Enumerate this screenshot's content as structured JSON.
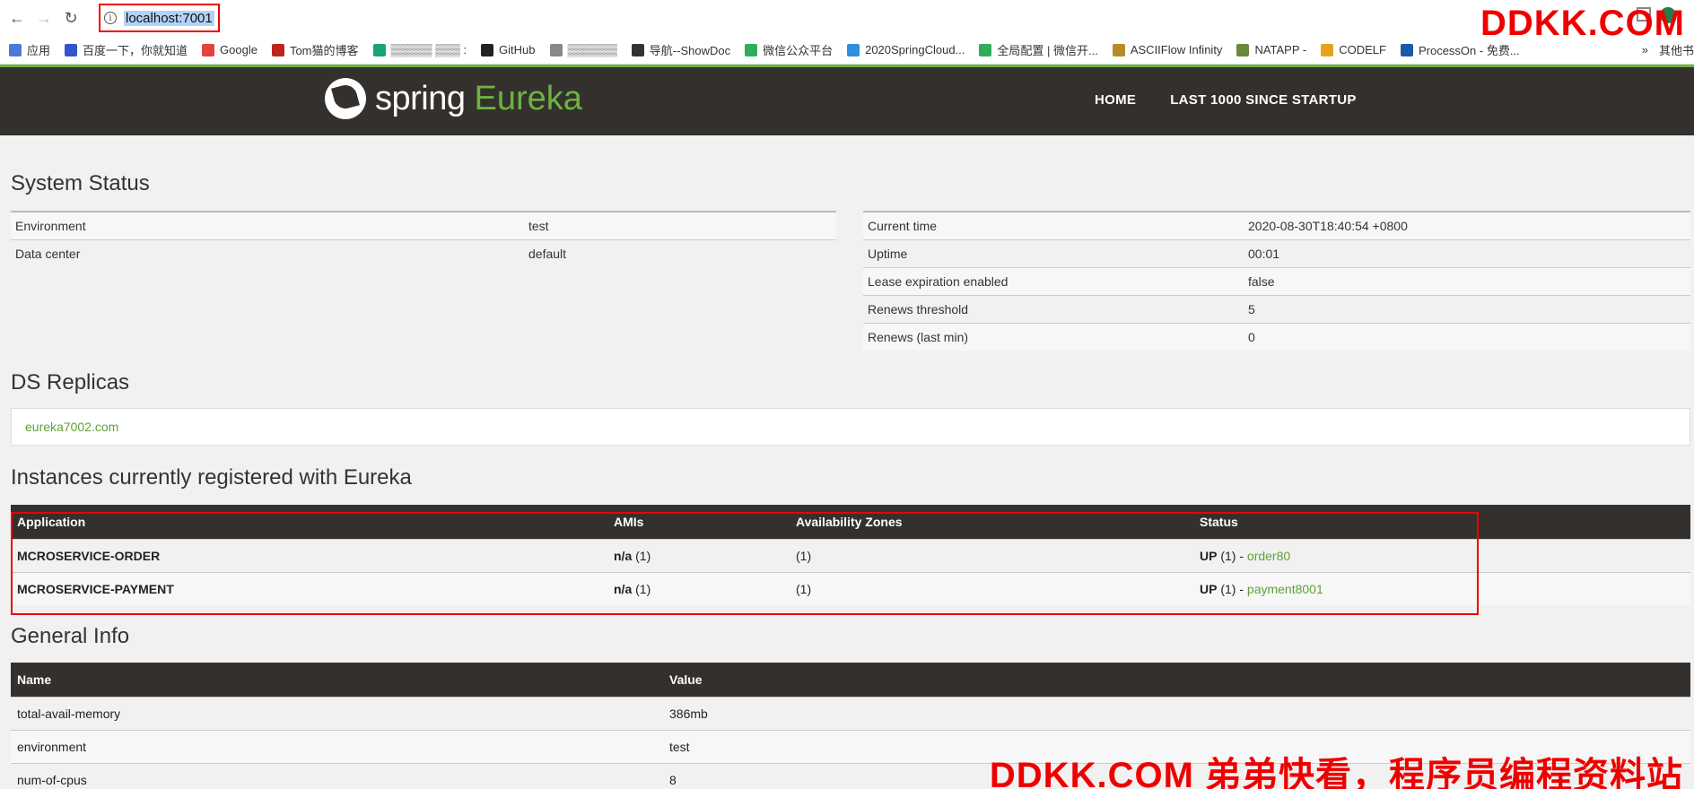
{
  "browser": {
    "url": "localhost:7001",
    "bookmarks": [
      {
        "label": "应用",
        "color": "#4a7bd4"
      },
      {
        "label": "百度一下，你就知道",
        "color": "#3355cc"
      },
      {
        "label": "Google",
        "color": "#e0443a"
      },
      {
        "label": "Tom猫的博客",
        "color": "#c0241e"
      },
      {
        "label": "▒▒▒▒▒ ▒▒▒ :",
        "color": "#1aa37a"
      },
      {
        "label": "GitHub",
        "color": "#222222"
      },
      {
        "label": "▒▒▒▒▒▒",
        "color": "#888888"
      },
      {
        "label": "导航--ShowDoc",
        "color": "#333333"
      },
      {
        "label": "微信公众平台",
        "color": "#2eae5a"
      },
      {
        "label": "2020SpringCloud...",
        "color": "#2f8ee0"
      },
      {
        "label": "全局配置 | 微信开...",
        "color": "#2eae5a"
      },
      {
        "label": "ASCIIFlow Infinity",
        "color": "#b88a2a"
      },
      {
        "label": "NATAPP -",
        "color": "#6a8a3a"
      },
      {
        "label": "CODELF",
        "color": "#e8a21a"
      },
      {
        "label": "ProcessOn - 免费...",
        "color": "#1a5aa8"
      }
    ],
    "more_label": "»",
    "other_bookmarks": "其他书"
  },
  "header": {
    "logo_spring": "spring",
    "logo_eureka": "Eureka",
    "nav": [
      "HOME",
      "LAST 1000 SINCE STARTUP"
    ]
  },
  "system_status": {
    "title": "System Status",
    "left": [
      {
        "k": "Environment",
        "v": "test"
      },
      {
        "k": "Data center",
        "v": "default"
      }
    ],
    "right": [
      {
        "k": "Current time",
        "v": "2020-08-30T18:40:54 +0800"
      },
      {
        "k": "Uptime",
        "v": "00:01"
      },
      {
        "k": "Lease expiration enabled",
        "v": "false"
      },
      {
        "k": "Renews threshold",
        "v": "5"
      },
      {
        "k": "Renews (last min)",
        "v": "0"
      }
    ]
  },
  "ds_replicas": {
    "title": "DS Replicas",
    "link": "eureka7002.com"
  },
  "instances": {
    "title": "Instances currently registered with Eureka",
    "headers": [
      "Application",
      "AMIs",
      "Availability Zones",
      "Status"
    ],
    "rows": [
      {
        "app": "MCROSERVICE-ORDER",
        "ami_bold": "n/a",
        "ami_count": " (1)",
        "zones": "(1)",
        "status_bold": "UP",
        "status_count": " (1) - ",
        "status_link": "order80"
      },
      {
        "app": "MCROSERVICE-PAYMENT",
        "ami_bold": "n/a",
        "ami_count": " (1)",
        "zones": "(1)",
        "status_bold": "UP",
        "status_count": " (1) - ",
        "status_link": "payment8001"
      }
    ]
  },
  "general_info": {
    "title": "General Info",
    "headers": [
      "Name",
      "Value"
    ],
    "rows": [
      {
        "name": "total-avail-memory",
        "value": "386mb"
      },
      {
        "name": "environment",
        "value": "test"
      },
      {
        "name": "num-of-cpus",
        "value": "8"
      }
    ]
  },
  "watermarks": {
    "top": "DDKK.COM",
    "bottom": "DDKK.COM 弟弟快看，程序员编程资料站"
  }
}
